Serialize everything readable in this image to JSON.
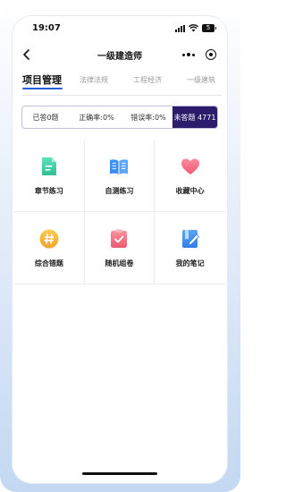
{
  "status_bar": {
    "time": "19:07",
    "battery": "5"
  },
  "nav": {
    "title": "一级建造师"
  },
  "tabs": [
    {
      "label": "项目管理",
      "active": true
    },
    {
      "label": "法律法规",
      "active": false
    },
    {
      "label": "工程经济",
      "active": false
    },
    {
      "label": "一级建筑",
      "active": false
    }
  ],
  "stats": {
    "answered": "已答0题",
    "correct_rate": "正确率:0%",
    "wrong_rate": "错误率:0%",
    "unanswered": "未答题 4771"
  },
  "menu": [
    {
      "label": "章节练习",
      "icon": "document-icon",
      "color": "#3ecfa6"
    },
    {
      "label": "自测练习",
      "icon": "book-icon",
      "color": "#3a8ff2"
    },
    {
      "label": "收藏中心",
      "icon": "heart-icon",
      "color": "#f06b84"
    },
    {
      "label": "综合错题",
      "icon": "hash-icon",
      "color": "#f3b33a"
    },
    {
      "label": "随机组卷",
      "icon": "checklist-icon",
      "color": "#ee6b7d"
    },
    {
      "label": "我的笔记",
      "icon": "notebook-pen-icon",
      "color": "#3a8ff2"
    }
  ],
  "colors": {
    "accent": "#2b5fd9",
    "unanswered_bg": "#2d1b6b",
    "stats_border": "#c6bfdc"
  }
}
